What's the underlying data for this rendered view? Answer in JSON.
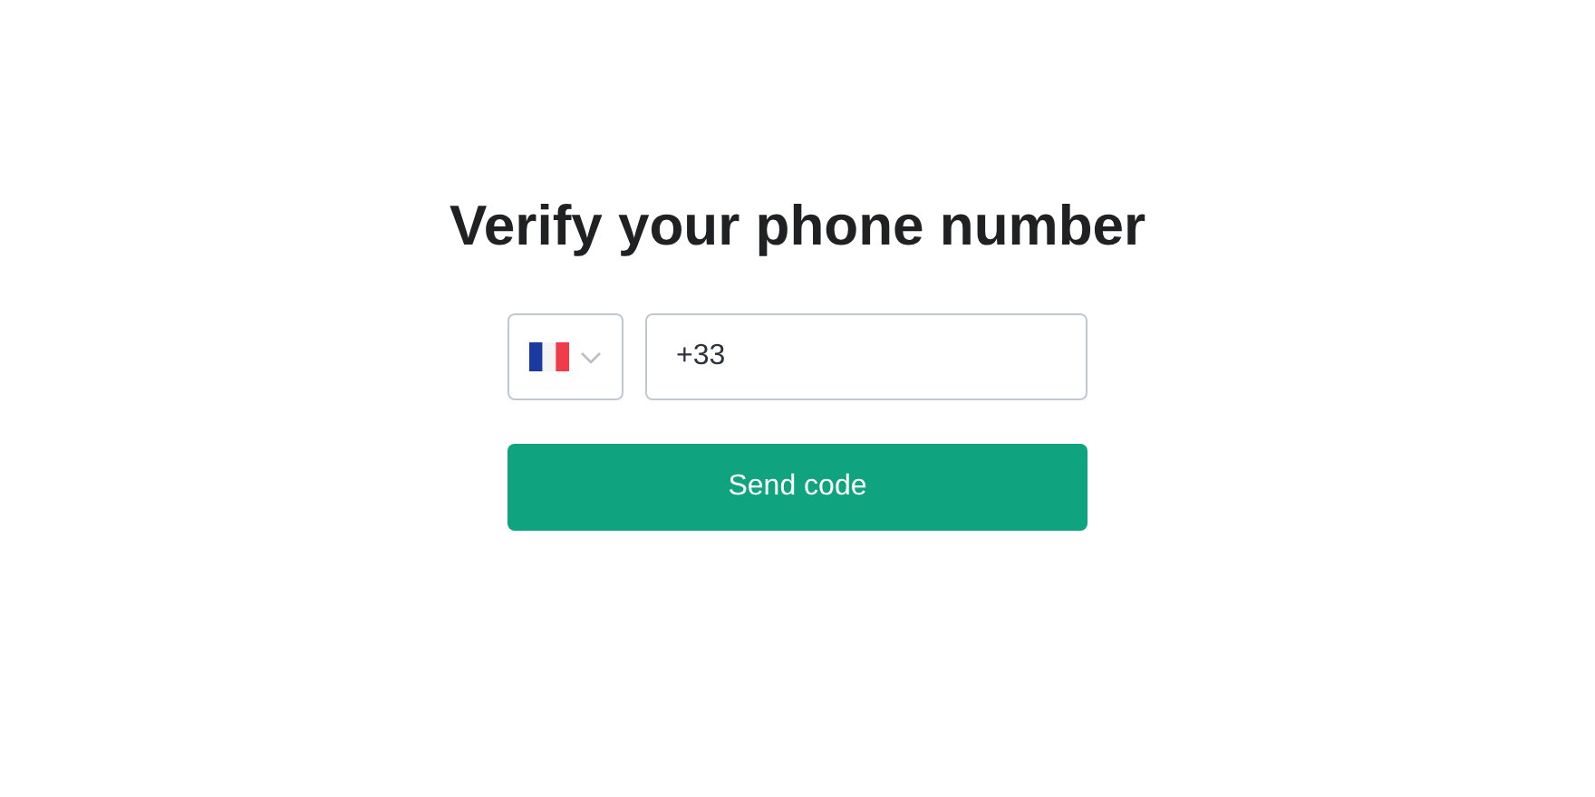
{
  "title": "Verify your phone number",
  "phone": {
    "value": "+33"
  },
  "button": {
    "label": "Send code"
  }
}
